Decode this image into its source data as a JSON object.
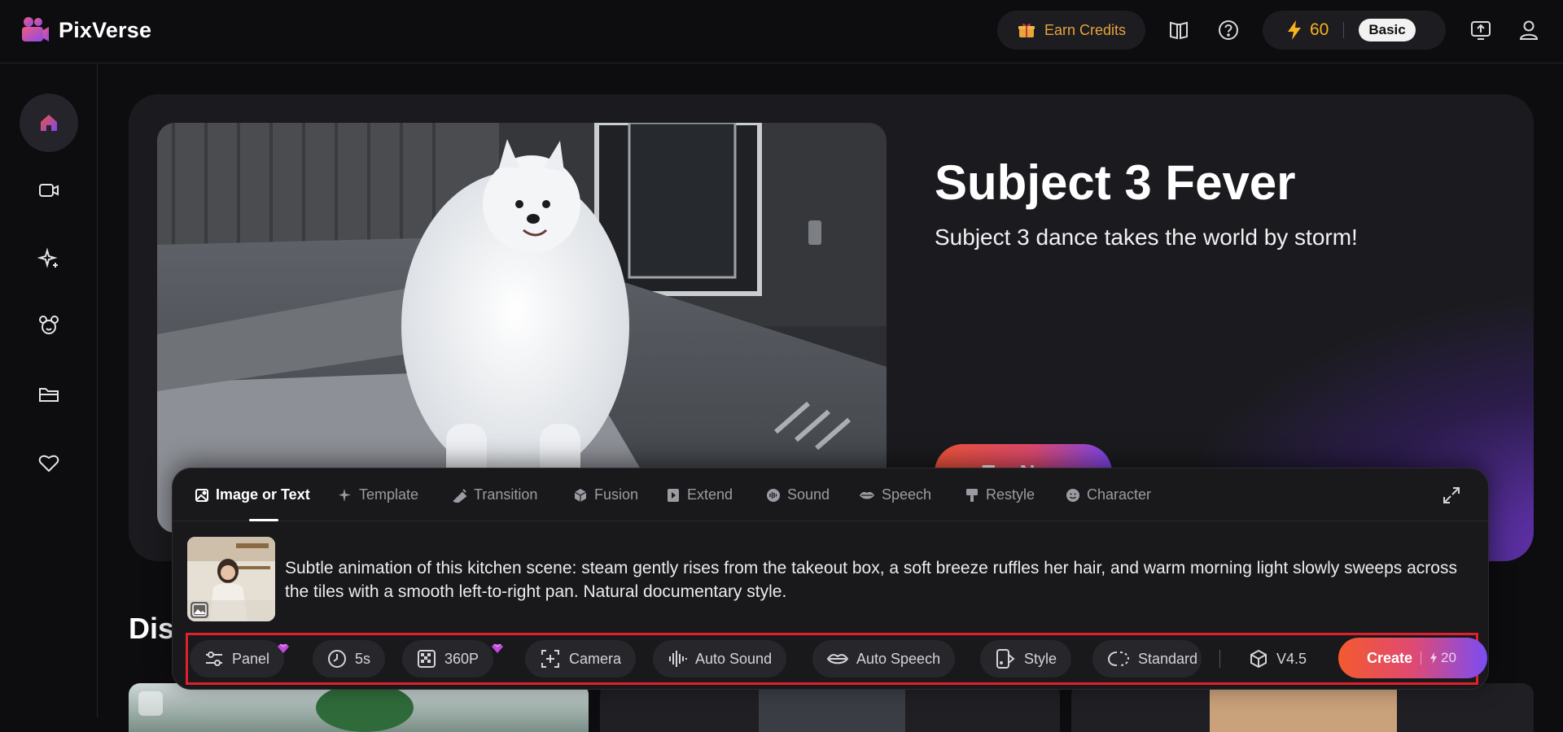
{
  "header": {
    "brand": "PixVerse",
    "earn_credits_label": "Earn Credits",
    "credits": "60",
    "plan": "Basic",
    "icons": [
      "gift-icon",
      "book-icon",
      "help-icon",
      "lightning-icon",
      "upload-icon",
      "user-icon"
    ]
  },
  "sidebar": {
    "items": [
      {
        "icon": "home-icon",
        "active": true
      },
      {
        "icon": "video-icon"
      },
      {
        "icon": "sparkle-icon"
      },
      {
        "icon": "character-icon"
      },
      {
        "icon": "folder-icon"
      },
      {
        "icon": "heart-icon"
      }
    ]
  },
  "hero": {
    "title": "Subject 3 Fever",
    "subtitle": "Subject 3 dance takes the world by storm!",
    "cta": "Try Now"
  },
  "section": {
    "title": "Discover"
  },
  "composer": {
    "tabs": [
      {
        "label": "Image or Text",
        "icon": "image-icon",
        "active": true
      },
      {
        "label": "Template",
        "icon": "sparkle-icon"
      },
      {
        "label": "Transition",
        "icon": "transition-icon"
      },
      {
        "label": "Fusion",
        "icon": "cube-icon"
      },
      {
        "label": "Extend",
        "icon": "extend-icon"
      },
      {
        "label": "Sound",
        "icon": "sound-icon"
      },
      {
        "label": "Speech",
        "icon": "lips-icon"
      },
      {
        "label": "Restyle",
        "icon": "brush-icon"
      },
      {
        "label": "Character",
        "icon": "smile-icon"
      }
    ],
    "prompt": "Subtle animation of this kitchen scene: steam gently rises from the takeout box, a soft breeze ruffles her hair, and warm morning light slowly sweeps across the tiles with a smooth left-to-right pan. Natural documentary style.",
    "toolbar": {
      "panel": "Panel",
      "duration": "5s",
      "quality": "360P",
      "camera": "Camera",
      "auto_sound": "Auto Sound",
      "auto_speech": "Auto Speech",
      "style": "Style",
      "mode": "Standard",
      "model": "V4.5",
      "create": "Create",
      "create_cost": "20"
    }
  },
  "colors": {
    "accent_orange": "#f35a2e",
    "accent_purple": "#7a4cf5",
    "credit_gold": "#f6b41e",
    "highlight_red": "#e0202c"
  }
}
